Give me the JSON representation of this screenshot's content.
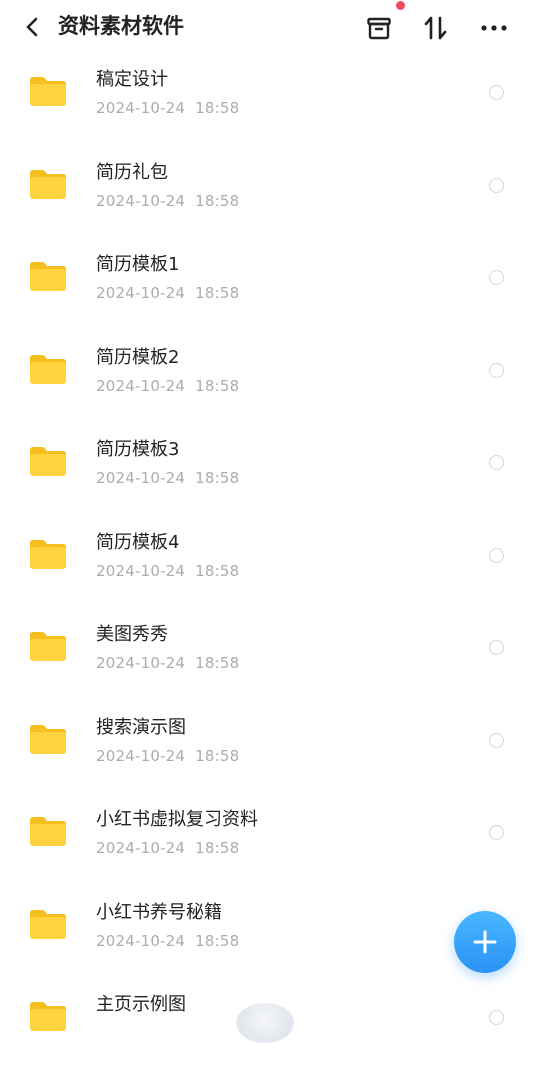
{
  "header": {
    "title": "资料素材软件"
  },
  "files": [
    {
      "name": "稿定设计",
      "date": "2024-10-24",
      "time": "18:58"
    },
    {
      "name": "简历礼包",
      "date": "2024-10-24",
      "time": "18:58"
    },
    {
      "name": "简历模板1",
      "date": "2024-10-24",
      "time": "18:58"
    },
    {
      "name": "简历模板2",
      "date": "2024-10-24",
      "time": "18:58"
    },
    {
      "name": "简历模板3",
      "date": "2024-10-24",
      "time": "18:58"
    },
    {
      "name": "简历模板4",
      "date": "2024-10-24",
      "time": "18:58"
    },
    {
      "name": "美图秀秀",
      "date": "2024-10-24",
      "time": "18:58"
    },
    {
      "name": "搜索演示图",
      "date": "2024-10-24",
      "time": "18:58"
    },
    {
      "name": "小红书虚拟复习资料",
      "date": "2024-10-24",
      "time": "18:58"
    },
    {
      "name": "小红书养号秘籍",
      "date": "2024-10-24",
      "time": "18:58"
    },
    {
      "name": "主页示例图",
      "date": "",
      "time": ""
    }
  ],
  "icons": {
    "back": "chevron-left-icon",
    "archive": "archive-box-icon",
    "sort": "sort-arrows-icon",
    "more": "more-dots-icon",
    "folder": "folder-icon",
    "fab": "plus-icon"
  },
  "colors": {
    "folder": "#ffd23f",
    "fab": "#2b93f5",
    "badge": "#ef4b5f"
  }
}
